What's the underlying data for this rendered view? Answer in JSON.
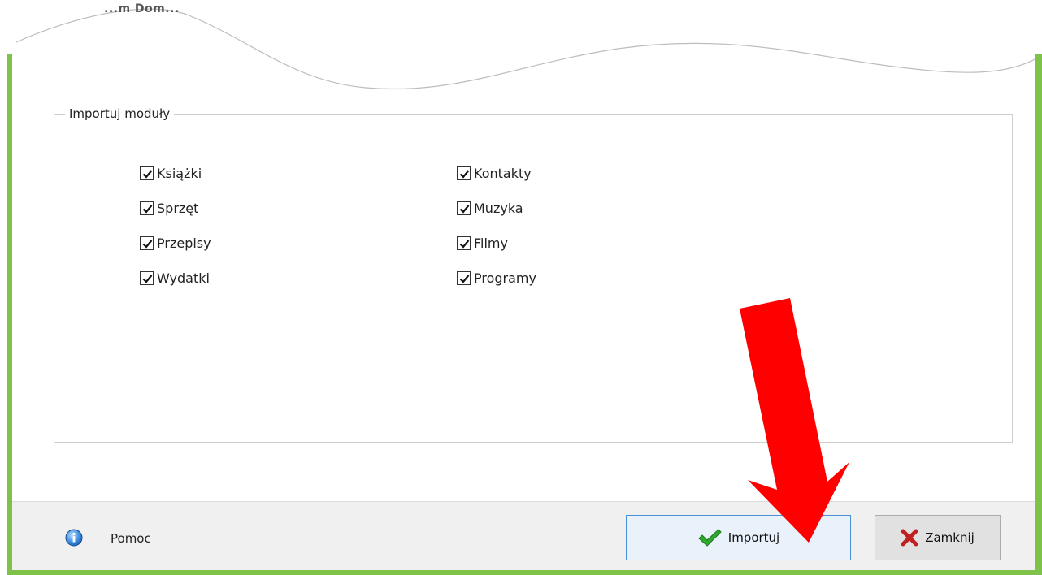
{
  "window": {
    "title_fragment": "...m Dom..."
  },
  "group": {
    "title": "Importuj moduły"
  },
  "modules": {
    "books": {
      "label": "Książki",
      "checked": true
    },
    "equipment": {
      "label": "Sprzęt",
      "checked": true
    },
    "recipes": {
      "label": "Przepisy",
      "checked": true
    },
    "expenses": {
      "label": "Wydatki",
      "checked": true
    },
    "contacts": {
      "label": "Kontakty",
      "checked": true
    },
    "music": {
      "label": "Muzyka",
      "checked": true
    },
    "movies": {
      "label": "Filmy",
      "checked": true
    },
    "programs": {
      "label": "Programy",
      "checked": true
    }
  },
  "footer": {
    "help_label": "Pomoc",
    "import_label": "Importuj",
    "close_label": "Zamknij"
  },
  "icons": {
    "help": "info-icon",
    "import": "checkmark-icon",
    "close": "x-icon",
    "annotation": "red-arrow"
  },
  "colors": {
    "frame_green": "#7fc24a",
    "import_border": "#4a90d9",
    "arrow_red": "#ff0000",
    "check_green": "#2ea82e",
    "close_red": "#c0201f"
  }
}
